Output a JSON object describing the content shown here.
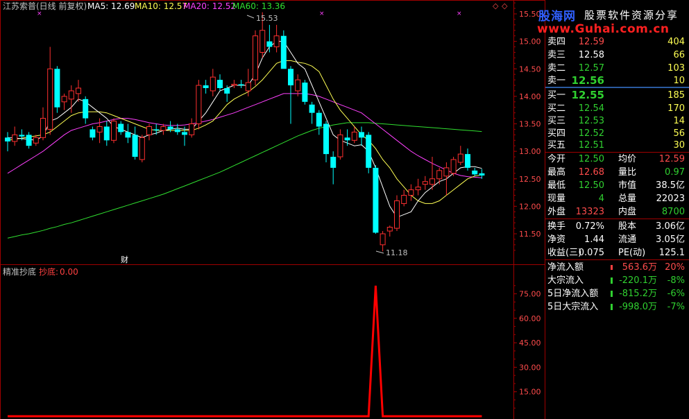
{
  "header": {
    "title": "江苏索普(日线 前复权)",
    "ma5": "MA5: 12.69",
    "ma10": "MA10: 12.57",
    "ma20": "MA20: 12.52",
    "ma60": "MA60: 13.36"
  },
  "colors": {
    "up": "#ff3030",
    "down": "#00ffff",
    "ma5": "#ffffff",
    "ma10": "#ffff54",
    "ma20": "#ff40ff",
    "ma60": "#30e030",
    "axis": "#a00000",
    "indicator": "#ff0000"
  },
  "price_axis": [
    "15.50",
    "15.00",
    "14.50",
    "14.00",
    "13.50",
    "13.00",
    "12.50",
    "12.00",
    "11.50"
  ],
  "price_markers": {
    "high": "15.53",
    "low": "11.18"
  },
  "fin_marker": "财",
  "indicator": {
    "name": "精准抄底",
    "series_label": "抄底:",
    "series_value": "0.00",
    "axis": [
      "75.00",
      "60.00",
      "45.00",
      "30.00",
      "15.00"
    ]
  },
  "watermark": {
    "brand": "股海网",
    "slogan": "股票软件资源分享",
    "url": "www.Guhai.com.cn"
  },
  "quote": {
    "sell": [
      {
        "label": "卖四",
        "price": "12.59",
        "vol": "404"
      },
      {
        "label": "卖三",
        "price": "12.58",
        "vol": "66"
      },
      {
        "label": "卖二",
        "price": "12.57",
        "vol": "103"
      },
      {
        "label": "卖一",
        "price": "12.56",
        "vol": "10"
      }
    ],
    "buy": [
      {
        "label": "买一",
        "price": "12.55",
        "vol": "185"
      },
      {
        "label": "买二",
        "price": "12.54",
        "vol": "170"
      },
      {
        "label": "买三",
        "price": "12.53",
        "vol": "14"
      },
      {
        "label": "买四",
        "price": "12.52",
        "vol": "56"
      },
      {
        "label": "买五",
        "price": "12.51",
        "vol": "30"
      }
    ],
    "stats": [
      {
        "l1": "今开",
        "v1": "12.50",
        "l2": "均价",
        "v2": "12.59"
      },
      {
        "l1": "最高",
        "v1": "12.68",
        "l2": "量比",
        "v2": "0.97"
      },
      {
        "l1": "最低",
        "v1": "12.50",
        "l2": "市值",
        "v2": "38.5亿"
      },
      {
        "l1": "现量",
        "v1": "4",
        "l2": "总量",
        "v2": "22023"
      },
      {
        "l1": "外盘",
        "v1": "13323",
        "l2": "内盘",
        "v2": "8700"
      }
    ],
    "stats2": [
      {
        "l1": "换手",
        "v1": "0.72%",
        "l2": "股本",
        "v2": "3.06亿"
      },
      {
        "l1": "净资",
        "v1": "1.44",
        "l2": "流通",
        "v2": "3.05亿"
      },
      {
        "l1": "收益(三)",
        "v1": "0.075",
        "l2": "PE(动)",
        "v2": "125.1"
      }
    ],
    "flows": [
      {
        "label": "净流入额",
        "value": "563.6万",
        "pct": "20%"
      },
      {
        "label": "大宗流入",
        "value": "-220.1万",
        "pct": "-8%"
      },
      {
        "label": "5日净流入额",
        "value": "-815.2万",
        "pct": "-6%"
      },
      {
        "label": "5日大宗流入",
        "value": "-998.0万",
        "pct": "-7%"
      }
    ]
  },
  "chart_data": {
    "type": "candlestick",
    "ylim": [
      11.0,
      15.7
    ],
    "candles": [
      {
        "o": 13.25,
        "h": 13.35,
        "l": 13.0,
        "c": 13.18
      },
      {
        "o": 13.18,
        "h": 13.45,
        "l": 13.1,
        "c": 13.3
      },
      {
        "o": 13.3,
        "h": 13.4,
        "l": 13.2,
        "c": 13.27
      },
      {
        "o": 13.3,
        "h": 13.35,
        "l": 13.05,
        "c": 13.1
      },
      {
        "o": 13.15,
        "h": 13.3,
        "l": 13.1,
        "c": 13.25
      },
      {
        "o": 13.25,
        "h": 13.8,
        "l": 13.2,
        "c": 13.6
      },
      {
        "o": 13.4,
        "h": 14.9,
        "l": 13.3,
        "c": 14.5
      },
      {
        "o": 14.5,
        "h": 14.55,
        "l": 13.7,
        "c": 13.8
      },
      {
        "o": 13.9,
        "h": 14.05,
        "l": 13.75,
        "c": 14.0
      },
      {
        "o": 13.95,
        "h": 14.2,
        "l": 13.7,
        "c": 14.1
      },
      {
        "o": 14.05,
        "h": 14.3,
        "l": 13.9,
        "c": 14.15
      },
      {
        "o": 13.95,
        "h": 14.0,
        "l": 13.5,
        "c": 13.6
      },
      {
        "o": 13.4,
        "h": 13.45,
        "l": 13.2,
        "c": 13.25
      },
      {
        "o": 13.35,
        "h": 13.6,
        "l": 13.15,
        "c": 13.45
      },
      {
        "o": 13.45,
        "h": 13.55,
        "l": 13.1,
        "c": 13.2
      },
      {
        "o": 13.2,
        "h": 13.6,
        "l": 13.15,
        "c": 13.55
      },
      {
        "o": 13.5,
        "h": 13.55,
        "l": 13.3,
        "c": 13.35
      },
      {
        "o": 13.35,
        "h": 13.5,
        "l": 13.15,
        "c": 13.25
      },
      {
        "o": 13.3,
        "h": 13.45,
        "l": 12.85,
        "c": 12.9
      },
      {
        "o": 12.85,
        "h": 13.3,
        "l": 12.8,
        "c": 13.25
      },
      {
        "o": 13.3,
        "h": 13.5,
        "l": 13.2,
        "c": 13.45
      },
      {
        "o": 13.4,
        "h": 13.5,
        "l": 13.3,
        "c": 13.38
      },
      {
        "o": 13.38,
        "h": 13.5,
        "l": 13.3,
        "c": 13.45
      },
      {
        "o": 13.45,
        "h": 13.55,
        "l": 13.35,
        "c": 13.4
      },
      {
        "o": 13.4,
        "h": 13.5,
        "l": 13.3,
        "c": 13.35
      },
      {
        "o": 13.35,
        "h": 13.45,
        "l": 13.1,
        "c": 13.3
      },
      {
        "o": 13.3,
        "h": 13.6,
        "l": 13.25,
        "c": 13.5
      },
      {
        "o": 13.5,
        "h": 14.3,
        "l": 13.4,
        "c": 14.2
      },
      {
        "o": 14.2,
        "h": 14.3,
        "l": 14.05,
        "c": 14.15
      },
      {
        "o": 14.1,
        "h": 14.5,
        "l": 14.0,
        "c": 14.35
      },
      {
        "o": 14.3,
        "h": 14.4,
        "l": 14.1,
        "c": 14.15
      },
      {
        "o": 14.15,
        "h": 14.2,
        "l": 13.9,
        "c": 14.05
      },
      {
        "o": 14.2,
        "h": 14.3,
        "l": 14.15,
        "c": 14.22
      },
      {
        "o": 14.22,
        "h": 14.3,
        "l": 14.15,
        "c": 14.2
      },
      {
        "o": 14.1,
        "h": 14.5,
        "l": 14.0,
        "c": 14.25
      },
      {
        "o": 14.3,
        "h": 15.2,
        "l": 14.2,
        "c": 15.1
      },
      {
        "o": 14.8,
        "h": 15.53,
        "l": 14.7,
        "c": 15.2
      },
      {
        "o": 15.0,
        "h": 15.3,
        "l": 14.8,
        "c": 14.9
      },
      {
        "o": 14.9,
        "h": 15.3,
        "l": 14.8,
        "c": 15.1
      },
      {
        "o": 15.1,
        "h": 15.2,
        "l": 14.8,
        "c": 14.5
      },
      {
        "o": 14.5,
        "h": 14.55,
        "l": 13.5,
        "c": 14.2
      },
      {
        "o": 14.1,
        "h": 14.4,
        "l": 14.0,
        "c": 14.3
      },
      {
        "o": 14.25,
        "h": 14.3,
        "l": 13.85,
        "c": 13.9
      },
      {
        "o": 13.85,
        "h": 13.9,
        "l": 13.5,
        "c": 13.7
      },
      {
        "o": 13.7,
        "h": 13.75,
        "l": 13.3,
        "c": 13.45
      },
      {
        "o": 13.5,
        "h": 13.55,
        "l": 12.8,
        "c": 12.95
      },
      {
        "o": 12.9,
        "h": 13.0,
        "l": 12.4,
        "c": 12.7
      },
      {
        "o": 12.9,
        "h": 13.4,
        "l": 12.85,
        "c": 13.3
      },
      {
        "o": 13.25,
        "h": 13.4,
        "l": 13.1,
        "c": 13.2
      },
      {
        "o": 13.2,
        "h": 13.45,
        "l": 13.15,
        "c": 13.35
      },
      {
        "o": 13.35,
        "h": 13.45,
        "l": 13.1,
        "c": 13.25
      },
      {
        "o": 13.3,
        "h": 13.35,
        "l": 12.6,
        "c": 12.7
      },
      {
        "o": 12.7,
        "h": 12.75,
        "l": 11.5,
        "c": 11.52
      },
      {
        "o": 11.3,
        "h": 11.55,
        "l": 11.18,
        "c": 11.5
      },
      {
        "o": 11.55,
        "h": 11.65,
        "l": 11.45,
        "c": 11.62
      },
      {
        "o": 11.6,
        "h": 12.2,
        "l": 11.55,
        "c": 12.1
      },
      {
        "o": 12.05,
        "h": 12.3,
        "l": 12.0,
        "c": 12.2
      },
      {
        "o": 12.2,
        "h": 12.4,
        "l": 12.1,
        "c": 12.3
      },
      {
        "o": 12.3,
        "h": 12.5,
        "l": 12.2,
        "c": 12.35
      },
      {
        "o": 12.4,
        "h": 12.55,
        "l": 12.3,
        "c": 12.45
      },
      {
        "o": 12.4,
        "h": 12.9,
        "l": 12.3,
        "c": 12.5
      },
      {
        "o": 12.5,
        "h": 12.7,
        "l": 12.4,
        "c": 12.65
      },
      {
        "o": 12.55,
        "h": 12.8,
        "l": 12.2,
        "c": 12.7
      },
      {
        "o": 12.6,
        "h": 12.9,
        "l": 12.55,
        "c": 12.85
      },
      {
        "o": 12.8,
        "h": 13.1,
        "l": 12.75,
        "c": 12.95
      },
      {
        "o": 12.95,
        "h": 13.05,
        "l": 12.65,
        "c": 12.7
      },
      {
        "o": 12.65,
        "h": 12.7,
        "l": 12.55,
        "c": 12.58
      },
      {
        "o": 12.6,
        "h": 12.68,
        "l": 12.5,
        "c": 12.56
      }
    ],
    "ma5": [
      13.25,
      13.24,
      13.23,
      13.22,
      13.2,
      13.28,
      13.55,
      13.6,
      13.7,
      13.8,
      13.95,
      13.9,
      13.8,
      13.7,
      13.6,
      13.45,
      13.4,
      13.35,
      13.3,
      13.25,
      13.3,
      13.33,
      13.38,
      13.4,
      13.42,
      13.4,
      13.4,
      13.55,
      13.7,
      13.9,
      14.1,
      14.15,
      14.2,
      14.2,
      14.2,
      14.4,
      14.7,
      14.9,
      15.0,
      15.0,
      14.8,
      14.6,
      14.5,
      14.2,
      13.9,
      13.6,
      13.3,
      13.2,
      13.15,
      13.1,
      13.12,
      13.0,
      12.7,
      12.35,
      12.0,
      11.8,
      11.85,
      11.9,
      12.1,
      12.25,
      12.35,
      12.45,
      12.5,
      12.6,
      12.7,
      12.72,
      12.72,
      12.69
    ],
    "ma10": [
      13.2,
      13.22,
      13.24,
      13.26,
      13.28,
      13.3,
      13.35,
      13.45,
      13.55,
      13.65,
      13.7,
      13.72,
      13.72,
      13.72,
      13.7,
      13.65,
      13.6,
      13.55,
      13.5,
      13.45,
      13.4,
      13.38,
      13.38,
      13.38,
      13.38,
      13.38,
      13.38,
      13.42,
      13.48,
      13.55,
      13.7,
      13.85,
      13.95,
      14.02,
      14.08,
      14.18,
      14.3,
      14.45,
      14.6,
      14.65,
      14.65,
      14.62,
      14.6,
      14.55,
      14.45,
      14.2,
      13.95,
      13.75,
      13.6,
      13.45,
      13.3,
      13.2,
      13.05,
      12.85,
      12.7,
      12.5,
      12.35,
      12.2,
      12.1,
      12.05,
      12.05,
      12.1,
      12.2,
      12.3,
      12.4,
      12.5,
      12.55,
      12.57
    ],
    "ma20": [
      12.6,
      12.68,
      12.76,
      12.84,
      12.92,
      13.0,
      13.1,
      13.2,
      13.3,
      13.38,
      13.42,
      13.46,
      13.5,
      13.52,
      13.55,
      13.58,
      13.6,
      13.6,
      13.58,
      13.55,
      13.52,
      13.5,
      13.48,
      13.47,
      13.47,
      13.48,
      13.5,
      13.52,
      13.55,
      13.58,
      13.62,
      13.66,
      13.7,
      13.75,
      13.8,
      13.85,
      13.9,
      13.95,
      14.0,
      14.05,
      14.05,
      14.05,
      14.05,
      14.03,
      14.0,
      13.95,
      13.9,
      13.85,
      13.8,
      13.75,
      13.7,
      13.6,
      13.5,
      13.4,
      13.3,
      13.2,
      13.1,
      13.0,
      12.92,
      12.85,
      12.78,
      12.72,
      12.66,
      12.6,
      12.56,
      12.54,
      12.53,
      12.52
    ],
    "ma60": [
      11.42,
      11.45,
      11.48,
      11.5,
      11.53,
      11.56,
      11.6,
      11.63,
      11.67,
      11.7,
      11.74,
      11.78,
      11.82,
      11.86,
      11.9,
      11.94,
      11.98,
      12.02,
      12.06,
      12.1,
      12.14,
      12.18,
      12.22,
      12.27,
      12.32,
      12.37,
      12.42,
      12.47,
      12.52,
      12.57,
      12.62,
      12.68,
      12.74,
      12.8,
      12.86,
      12.92,
      12.98,
      13.04,
      13.1,
      13.16,
      13.22,
      13.28,
      13.33,
      13.38,
      13.42,
      13.45,
      13.48,
      13.5,
      13.52,
      13.52,
      13.52,
      13.52,
      13.51,
      13.5,
      13.49,
      13.48,
      13.47,
      13.46,
      13.45,
      13.44,
      13.43,
      13.42,
      13.41,
      13.4,
      13.39,
      13.38,
      13.37,
      13.36
    ],
    "indicator_ylim": [
      0,
      85
    ],
    "indicator_values": [
      0,
      0,
      0,
      0,
      0,
      0,
      0,
      0,
      0,
      0,
      0,
      0,
      0,
      0,
      0,
      0,
      0,
      0,
      0,
      0,
      0,
      0,
      0,
      0,
      0,
      0,
      0,
      0,
      0,
      0,
      0,
      0,
      0,
      0,
      0,
      0,
      0,
      0,
      0,
      0,
      0,
      0,
      0,
      0,
      0,
      0,
      0,
      0,
      0,
      0,
      0,
      0,
      80,
      0,
      0,
      0,
      0,
      0,
      0,
      0,
      0,
      0,
      0,
      0,
      0,
      0,
      0,
      0
    ]
  }
}
